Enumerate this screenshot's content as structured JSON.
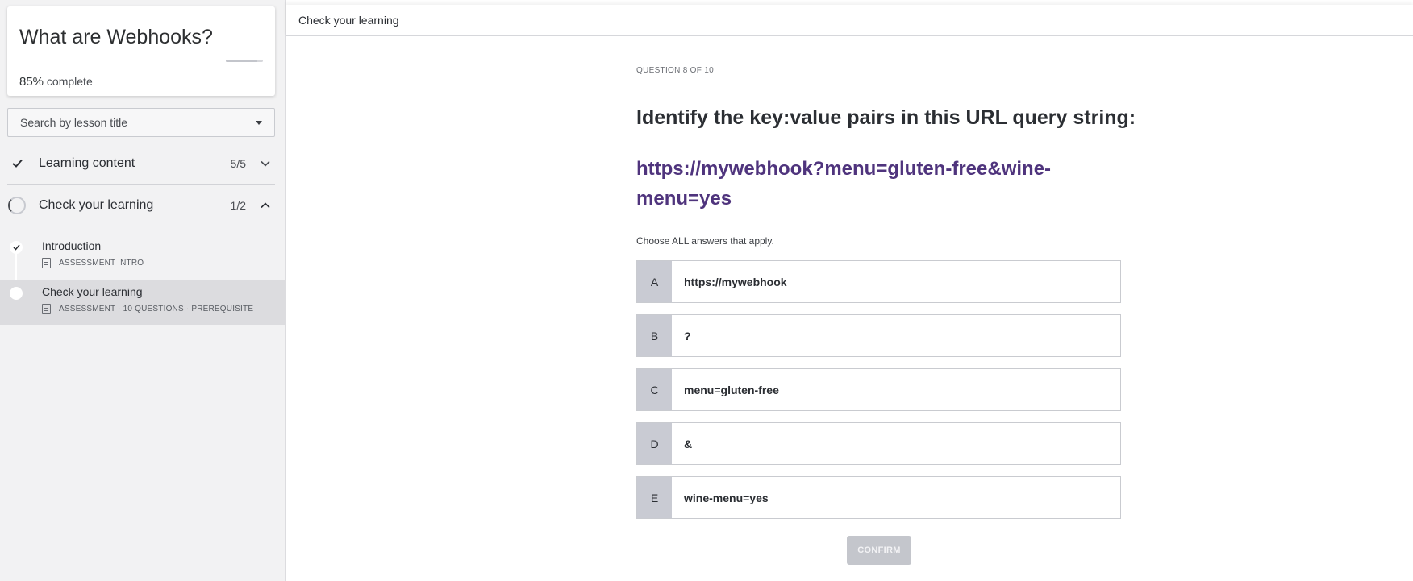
{
  "sidebar": {
    "course_title": "What are Webhooks?",
    "progress_percent": 85,
    "progress_pct_label": "85%",
    "progress_suffix": "complete",
    "search_placeholder": "Search by lesson title",
    "sections": [
      {
        "label": "Learning content",
        "count": "5/5",
        "status": "complete",
        "expanded": false
      },
      {
        "label": "Check your learning",
        "count": "1/2",
        "status": "in-progress",
        "expanded": true
      }
    ],
    "lessons": [
      {
        "title": "Introduction",
        "meta": "ASSESSMENT INTRO",
        "completed": true
      },
      {
        "title": "Check your learning",
        "meta": "ASSESSMENT · 10 QUESTIONS · PREREQUISITE",
        "completed": false,
        "active": true
      }
    ]
  },
  "topbar": {
    "title": "Check your learning"
  },
  "question": {
    "number_label": "QUESTION 8 OF 10",
    "prompt_before": "Identify the ",
    "prompt_bold": "key:value",
    "prompt_after": " pairs in this URL query string:",
    "url": "https://mywebhook?menu=gluten-free&wine-menu=yes",
    "instruction": "Choose ALL answers that apply.",
    "answers": [
      {
        "letter": "A",
        "text": "https://mywebhook"
      },
      {
        "letter": "B",
        "text": "?"
      },
      {
        "letter": "C",
        "text": "menu=gluten-free"
      },
      {
        "letter": "D",
        "text": "&"
      },
      {
        "letter": "E",
        "text": "wine-menu=yes"
      }
    ],
    "confirm_label": "CONFIRM"
  },
  "colors": {
    "accent_url": "#4f347d",
    "answer_letter_bg": "#c9cbd3",
    "confirm_disabled_bg": "#c4c6cc",
    "sidebar_bg": "#f2f2f3"
  },
  "icons": [
    "check-icon",
    "progress-ring-icon",
    "chevron-down-icon",
    "chevron-up-icon",
    "document-icon",
    "caret-down-icon"
  ]
}
